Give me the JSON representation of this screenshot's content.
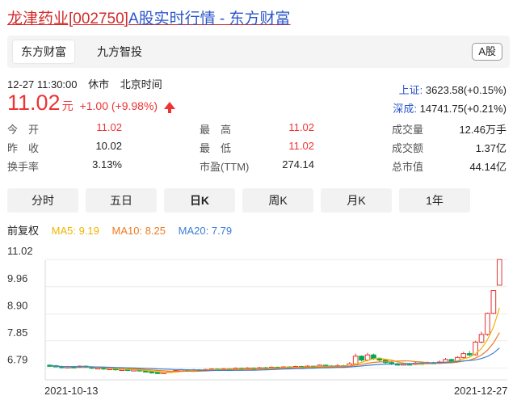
{
  "title": {
    "name_code": "龙津药业[002750]",
    "rest": "A股实时行情 - 东方财富"
  },
  "source_tabs": [
    "东方财富",
    "九方智投"
  ],
  "market_badge": "A股",
  "status": {
    "time": "12-27 11:30:00",
    "state": "休市",
    "zone": "北京时间"
  },
  "price": {
    "value": "11.02",
    "unit": "元",
    "change": "+1.00 (+9.98%)"
  },
  "indices": [
    {
      "name": "上证:",
      "value": " 3623.58(+0.15%)"
    },
    {
      "name": "深成:",
      "value": " 14741.75(+0.21%)"
    }
  ],
  "stats": [
    [
      {
        "label": "今　开",
        "value": "11.02",
        "red": true
      },
      {
        "label": "最　高",
        "value": "11.02",
        "red": true
      },
      {
        "label": "成交量",
        "value": "12.46万手",
        "red": false
      }
    ],
    [
      {
        "label": "昨　收",
        "value": "10.02",
        "red": false
      },
      {
        "label": "最　低",
        "value": "11.02",
        "red": true
      },
      {
        "label": "成交额",
        "value": "1.37亿",
        "red": false
      }
    ],
    [
      {
        "label": "换手率",
        "value": "3.13%",
        "red": false
      },
      {
        "label": "市盈(TTM)",
        "value": "274.14",
        "red": false
      },
      {
        "label": "总市值",
        "value": "44.14亿",
        "red": false
      }
    ]
  ],
  "period_tabs": [
    "分时",
    "五日",
    "日K",
    "周K",
    "月K",
    "1年"
  ],
  "active_period": "日K",
  "ma": {
    "label": "前复权",
    "ma5": "MA5: 9.19",
    "ma10": "MA10: 8.25",
    "ma20": "MA20: 7.79"
  },
  "colors": {
    "up": "#e33333",
    "down": "#00a850",
    "blue": "#2b56c8",
    "ma5": "#f0b400",
    "ma10": "#f07a20",
    "ma20": "#3c7fd6"
  },
  "chart_data": {
    "type": "candlestick",
    "y_ticks": [
      "11.02",
      "9.96",
      "8.90",
      "7.85",
      "6.79"
    ],
    "ylim": [
      6.5,
      11.1
    ],
    "x_labels": [
      "2021-10-13",
      "2021-12-27"
    ],
    "candles": [
      [
        6.9,
        6.88,
        6.93,
        6.84
      ],
      [
        6.88,
        6.85,
        6.91,
        6.82
      ],
      [
        6.85,
        6.8,
        6.88,
        6.77
      ],
      [
        6.8,
        6.84,
        6.87,
        6.78
      ],
      [
        6.84,
        6.82,
        6.87,
        6.79
      ],
      [
        6.82,
        6.86,
        6.89,
        6.8
      ],
      [
        6.86,
        6.83,
        6.89,
        6.8
      ],
      [
        6.83,
        6.78,
        6.85,
        6.75
      ],
      [
        6.78,
        6.8,
        6.83,
        6.75
      ],
      [
        6.8,
        6.75,
        6.82,
        6.72
      ],
      [
        6.75,
        6.77,
        6.8,
        6.72
      ],
      [
        6.77,
        6.72,
        6.79,
        6.69
      ],
      [
        6.72,
        6.74,
        6.77,
        6.7
      ],
      [
        6.74,
        6.7,
        6.76,
        6.67
      ],
      [
        6.7,
        6.72,
        6.75,
        6.68
      ],
      [
        6.72,
        6.68,
        6.74,
        6.65
      ],
      [
        6.68,
        6.65,
        6.7,
        6.62
      ],
      [
        6.65,
        6.6,
        6.67,
        6.57
      ],
      [
        6.62,
        6.58,
        6.64,
        6.55
      ],
      [
        6.58,
        6.62,
        6.64,
        6.55
      ],
      [
        6.62,
        6.66,
        6.68,
        6.6
      ],
      [
        6.66,
        6.69,
        6.72,
        6.64
      ],
      [
        6.69,
        6.72,
        6.75,
        6.67
      ],
      [
        6.72,
        6.68,
        6.74,
        6.65
      ],
      [
        6.68,
        6.72,
        6.75,
        6.66
      ],
      [
        6.72,
        6.7,
        6.74,
        6.68
      ],
      [
        6.7,
        6.73,
        6.76,
        6.68
      ],
      [
        6.73,
        6.75,
        6.78,
        6.71
      ],
      [
        6.75,
        6.72,
        6.77,
        6.7
      ],
      [
        6.72,
        6.76,
        6.79,
        6.7
      ],
      [
        6.76,
        6.74,
        6.78,
        6.72
      ],
      [
        6.74,
        6.78,
        6.81,
        6.72
      ],
      [
        6.78,
        6.75,
        6.8,
        6.73
      ],
      [
        6.75,
        6.79,
        6.82,
        6.73
      ],
      [
        6.79,
        6.76,
        6.81,
        6.74
      ],
      [
        6.76,
        6.8,
        6.83,
        6.74
      ],
      [
        6.8,
        6.78,
        6.83,
        6.76
      ],
      [
        6.78,
        6.82,
        6.85,
        6.76
      ],
      [
        6.82,
        6.79,
        6.84,
        6.77
      ],
      [
        6.79,
        6.83,
        6.86,
        6.77
      ],
      [
        6.83,
        6.8,
        6.85,
        6.78
      ],
      [
        6.8,
        6.85,
        6.88,
        6.78
      ],
      [
        6.85,
        6.82,
        6.87,
        6.8
      ],
      [
        6.82,
        6.86,
        6.9,
        6.8
      ],
      [
        6.86,
        6.83,
        6.88,
        6.8
      ],
      [
        6.83,
        6.9,
        6.93,
        6.81
      ],
      [
        6.9,
        6.87,
        6.92,
        6.84
      ],
      [
        6.87,
        6.82,
        6.9,
        6.8
      ],
      [
        6.82,
        6.88,
        6.95,
        6.8
      ],
      [
        6.88,
        6.85,
        6.91,
        6.82
      ],
      [
        6.85,
        6.95,
        7.02,
        6.83
      ],
      [
        6.95,
        7.25,
        7.35,
        6.92
      ],
      [
        7.25,
        7.1,
        7.28,
        7.05
      ],
      [
        7.1,
        7.3,
        7.38,
        7.05
      ],
      [
        7.3,
        7.15,
        7.35,
        7.1
      ],
      [
        7.15,
        7.1,
        7.2,
        7.02
      ],
      [
        7.1,
        7.0,
        7.12,
        6.95
      ],
      [
        7.0,
        6.95,
        7.05,
        6.9
      ],
      [
        6.95,
        6.92,
        6.99,
        6.88
      ],
      [
        6.92,
        6.95,
        6.99,
        6.89
      ],
      [
        6.95,
        6.93,
        6.98,
        6.9
      ],
      [
        6.93,
        6.98,
        7.02,
        6.91
      ],
      [
        6.98,
        6.96,
        7.01,
        6.93
      ],
      [
        6.96,
        7.0,
        7.04,
        6.94
      ],
      [
        7.0,
        6.98,
        7.03,
        6.95
      ],
      [
        6.98,
        7.02,
        7.08,
        6.96
      ],
      [
        7.02,
        7.12,
        7.18,
        7.0
      ],
      [
        7.12,
        7.05,
        7.15,
        7.0
      ],
      [
        7.05,
        7.2,
        7.25,
        7.03
      ],
      [
        7.2,
        7.35,
        7.42,
        7.15
      ],
      [
        7.35,
        7.3,
        7.45,
        7.25
      ],
      [
        7.3,
        7.8,
        7.85,
        7.28
      ],
      [
        7.8,
        8.1,
        8.2,
        7.75
      ],
      [
        8.1,
        8.92,
        8.95,
        8.05
      ],
      [
        8.92,
        9.81,
        9.81,
        8.9
      ],
      [
        10.02,
        11.02,
        11.02,
        11.02
      ]
    ]
  }
}
